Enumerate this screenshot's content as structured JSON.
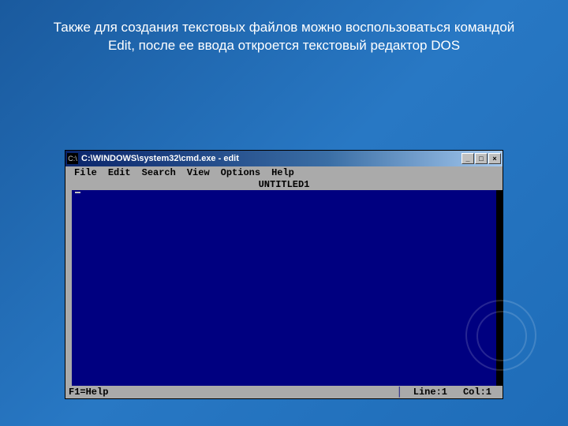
{
  "slide": {
    "caption": "Также для создания текстовых файлов можно воспользоваться командой Edit, после ее ввода откроется текстовый редактор DOS"
  },
  "window": {
    "title": "C:\\WINDOWS\\system32\\cmd.exe - edit",
    "sys_icon_label": "C:\\",
    "buttons": {
      "minimize": "_",
      "maximize": "□",
      "close": "×"
    }
  },
  "editor": {
    "menus": {
      "file": "File",
      "edit": "Edit",
      "search": "Search",
      "view": "View",
      "options": "Options",
      "help": "Help"
    },
    "document_title": "UNTITLED1",
    "status": {
      "help": "F1=Help",
      "line_label": "Line:",
      "line_value": "1",
      "col_label": "Col:",
      "col_value": "1"
    }
  }
}
